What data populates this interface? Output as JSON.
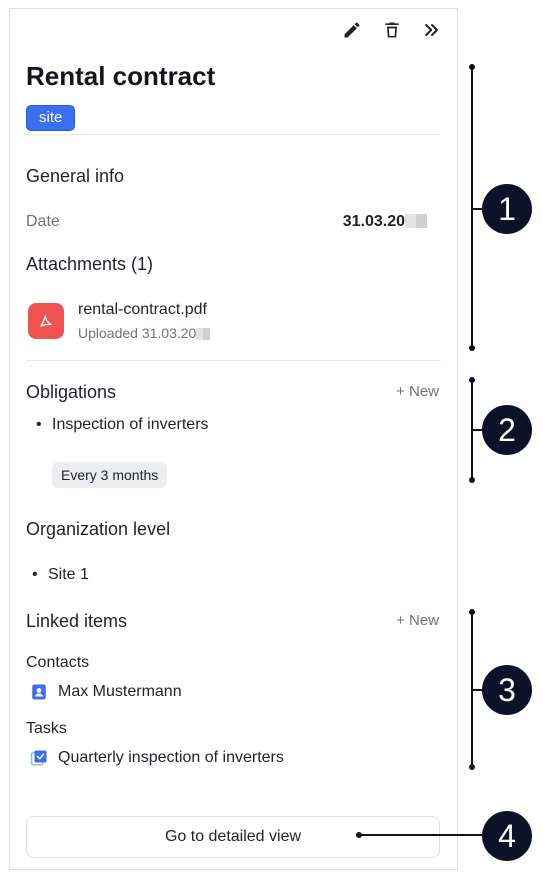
{
  "toolbar": {
    "edit_icon": "pencil-icon",
    "delete_icon": "trash-icon",
    "collapse_icon": "double-chevron-right-icon"
  },
  "header": {
    "title": "Rental contract",
    "badge": "site"
  },
  "general_info": {
    "heading": "General info",
    "date_label": "Date",
    "date_value": "31.03.20"
  },
  "attachments": {
    "heading": "Attachments (1)",
    "files": [
      {
        "name": "rental-contract.pdf",
        "uploaded": "Uploaded 31.03.20"
      }
    ]
  },
  "obligations": {
    "heading": "Obligations",
    "new_label": "+ New",
    "items": [
      {
        "title": "Inspection of inverters",
        "frequency": "Every 3 months"
      }
    ]
  },
  "organization_level": {
    "heading": "Organization level",
    "items": [
      "Site 1"
    ]
  },
  "linked_items": {
    "heading": "Linked items",
    "new_label": "+ New",
    "contacts_heading": "Contacts",
    "contacts": [
      "Max Mustermann"
    ],
    "tasks_heading": "Tasks",
    "tasks": [
      "Quarterly inspection of inverters"
    ]
  },
  "footer": {
    "detail_button": "Go to detailed view"
  },
  "annotations": [
    "1",
    "2",
    "3",
    "4"
  ],
  "colors": {
    "badge": "#3b6ff0",
    "pdf": "#ef5350",
    "annotation": "#0c1228",
    "icon_blue": "#3b6ff0"
  }
}
